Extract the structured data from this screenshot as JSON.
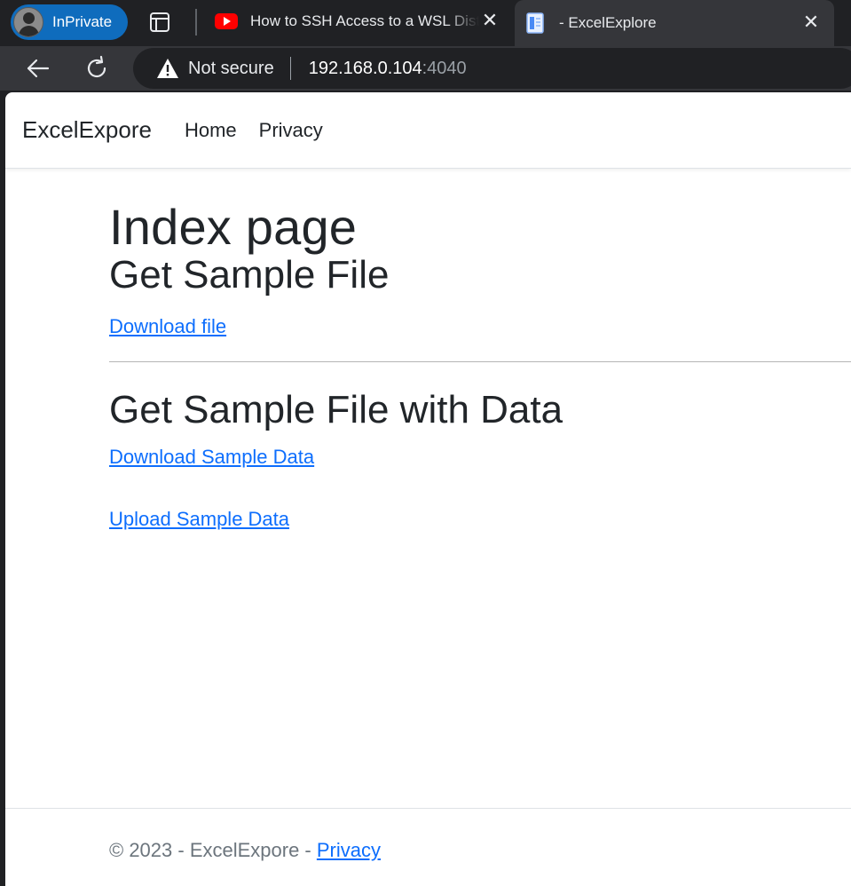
{
  "browser": {
    "profile_label": "InPrivate",
    "tabs": [
      {
        "title": "How to SSH Access to a WSL Distro",
        "active": false
      },
      {
        "title": "- ExcelExplore",
        "active": true
      }
    ],
    "address": {
      "security_label": "Not secure",
      "host": "192.168.0.104",
      "port": ":4040"
    },
    "colors": {
      "accent": "#0f6cbd",
      "chrome_dark": "#202124",
      "chrome_mid": "#35363a"
    }
  },
  "site": {
    "brand": "ExcelExpore",
    "nav": {
      "home": "Home",
      "privacy": "Privacy"
    }
  },
  "main": {
    "title": "Index page",
    "section1_heading": "Get Sample File",
    "download_file_link": "Download file",
    "section2_heading": "Get Sample File with Data",
    "download_sample_link": "Download Sample Data",
    "upload_sample_link": "Upload Sample Data",
    "link_color": "#0d6efd"
  },
  "footer": {
    "copyright": "© 2023 - ExcelExpore - ",
    "privacy_link": "Privacy"
  }
}
